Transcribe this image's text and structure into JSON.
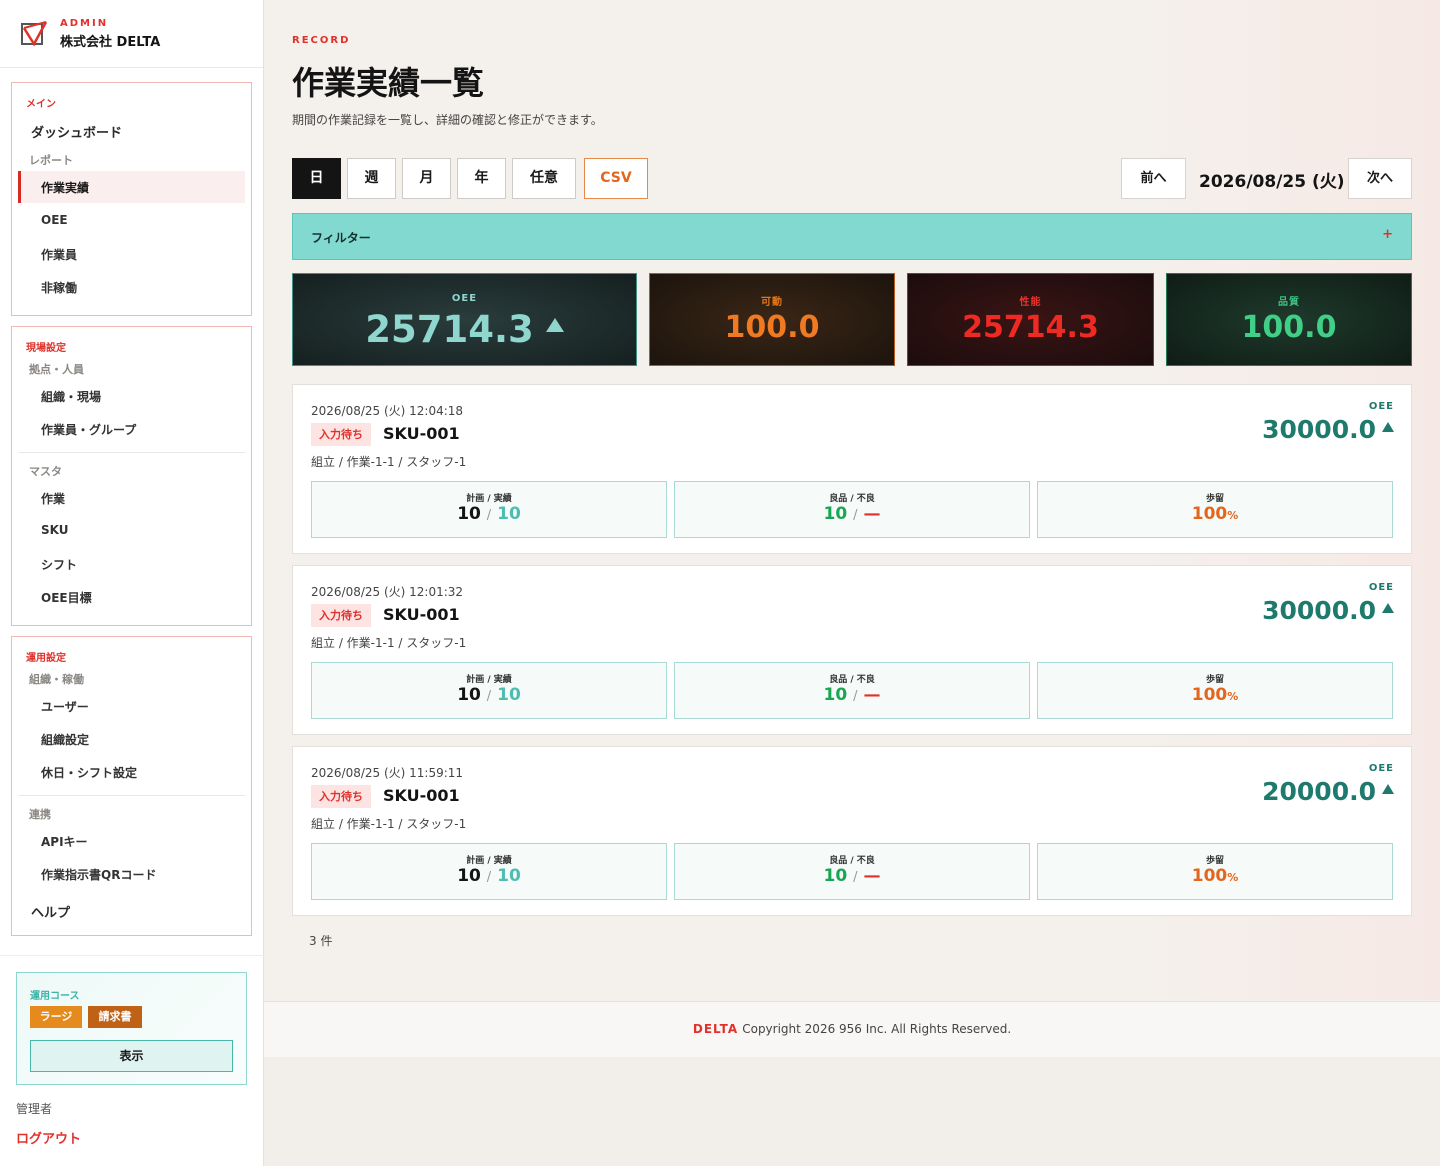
{
  "brand": {
    "eyebrow": "ADMIN",
    "company": "株式会社 DELTA"
  },
  "sidebar": {
    "main": {
      "title": "メイン",
      "dashboard": "ダッシュボード",
      "report_heading": "レポート",
      "items": [
        "作業実績",
        "OEE",
        "作業員",
        "非稼働"
      ],
      "active": "作業実績"
    },
    "site": {
      "title": "現場設定",
      "sub1": "拠点・人員",
      "items1": [
        "組織・現場",
        "作業員・グループ"
      ],
      "sub2": "マスタ",
      "items2": [
        "作業",
        "SKU",
        "シフト",
        "OEE目標"
      ]
    },
    "ops": {
      "title": "運用設定",
      "sub1": "組織・稼働",
      "items1": [
        "ユーザー",
        "組織設定",
        "休日・シフト設定"
      ],
      "sub2": "連携",
      "items2": [
        "APIキー",
        "作業指示書QRコード"
      ],
      "help": "ヘルプ"
    },
    "course": {
      "title": "運用コース",
      "plan_badge": "ラージ",
      "invoice_badge": "請求書",
      "show_button": "表示"
    },
    "admin_label": "管理者",
    "logout": "ログアウト"
  },
  "header": {
    "eyebrow": "RECORD",
    "title": "作業実績一覧",
    "description": "期間の作業記録を一覧し、詳細の確認と修正ができます。"
  },
  "toolbar": {
    "periods": [
      "日",
      "週",
      "月",
      "年",
      "任意"
    ],
    "active_period": "日",
    "csv": "CSV",
    "prev": "前へ",
    "date": "2026/08/25 (火)",
    "next": "次へ"
  },
  "filter": {
    "label": "フィルター",
    "toggle": "+"
  },
  "kpis": {
    "oee": {
      "label": "OEE",
      "value": "25714.3",
      "trend": "up"
    },
    "availability": {
      "label": "可動",
      "value": "100.0"
    },
    "performance": {
      "label": "性能",
      "value": "25714.3"
    },
    "quality": {
      "label": "品質",
      "value": "100.0"
    }
  },
  "records": [
    {
      "time": "2026/08/25 (火) 12:04:18",
      "status": "入力待ち",
      "sku": "SKU-001",
      "path": "組立 / 作業-1-1 / スタッフ-1",
      "oee_label": "OEE",
      "oee": "30000.0",
      "plan_label": "計画 / 実績",
      "plan": "10",
      "actual": "10",
      "quality_label": "良品 / 不良",
      "good": "10",
      "bad": "—",
      "yield_label": "歩留",
      "yield": "100",
      "yield_unit": "%",
      "sep": "/"
    },
    {
      "time": "2026/08/25 (火) 12:01:32",
      "status": "入力待ち",
      "sku": "SKU-001",
      "path": "組立 / 作業-1-1 / スタッフ-1",
      "oee_label": "OEE",
      "oee": "30000.0",
      "plan_label": "計画 / 実績",
      "plan": "10",
      "actual": "10",
      "quality_label": "良品 / 不良",
      "good": "10",
      "bad": "—",
      "yield_label": "歩留",
      "yield": "100",
      "yield_unit": "%",
      "sep": "/"
    },
    {
      "time": "2026/08/25 (火) 11:59:11",
      "status": "入力待ち",
      "sku": "SKU-001",
      "path": "組立 / 作業-1-1 / スタッフ-1",
      "oee_label": "OEE",
      "oee": "20000.0",
      "plan_label": "計画 / 実績",
      "plan": "10",
      "actual": "10",
      "quality_label": "良品 / 不良",
      "good": "10",
      "bad": "—",
      "yield_label": "歩留",
      "yield": "100",
      "yield_unit": "%",
      "sep": "/"
    }
  ],
  "count": "3 件",
  "footer": {
    "brand": "DELTA",
    "copyright": "Copyright 2026 956 Inc. All Rights Reserved."
  },
  "colors": {
    "accent": "#e0312b",
    "teal": "#82d9d0",
    "oee_green": "#1f7a6e",
    "orange": "#e4661c"
  }
}
